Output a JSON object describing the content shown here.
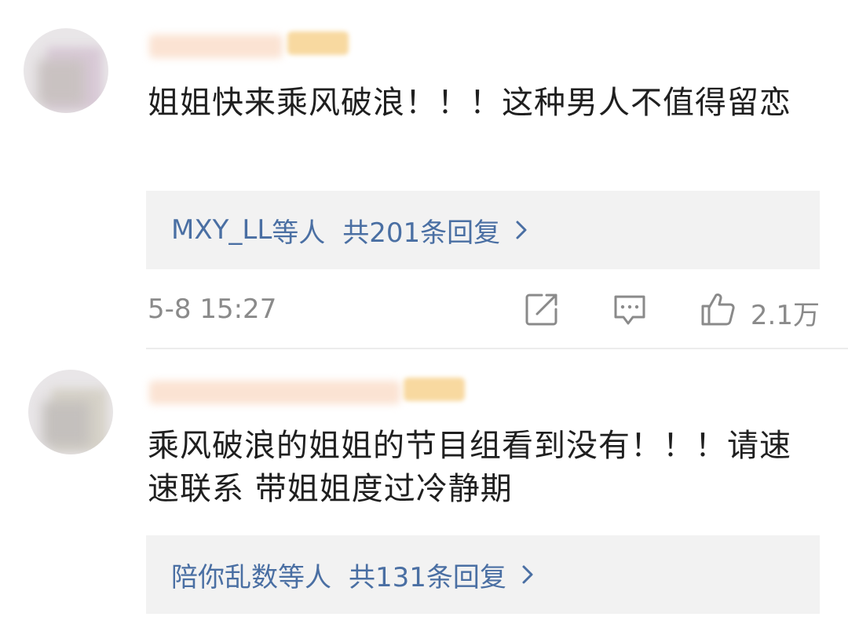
{
  "comments": [
    {
      "text": "姐姐快来乘风破浪！！！这种男人不值得留恋",
      "reply_users": "MXY_LL",
      "reply_users_suffix": "等人",
      "reply_count": "共201条回复",
      "time": "5-8 15:27",
      "likes": "2.1万"
    },
    {
      "text": "乘风破浪的姐姐的节目组看到没有！！！请速速联系 带姐姐度过冷静期",
      "reply_users": "陪你乱数",
      "reply_users_suffix": "等人",
      "reply_count": "共131条回复"
    }
  ],
  "icons": {
    "share": "share-icon",
    "comment": "comment-icon",
    "like": "thumbs-up-icon",
    "reply_more": "chevron-right-icon"
  },
  "colors": {
    "link": "#4a6fa3",
    "meta": "#8a8a8a",
    "reply_bg": "#f2f2f2"
  }
}
